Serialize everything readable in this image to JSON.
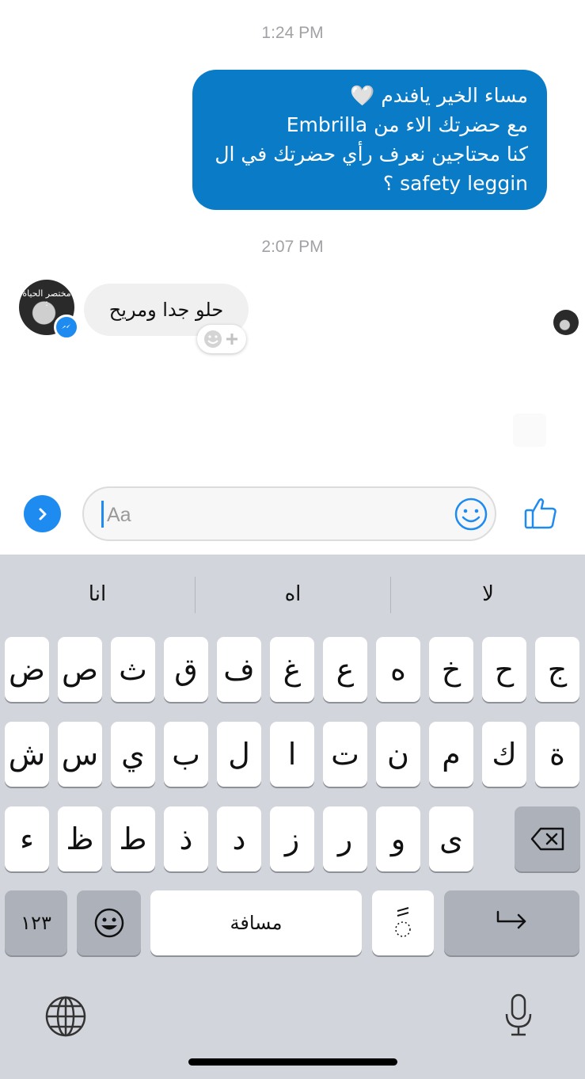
{
  "chat": {
    "timestamp_1": "1:24 PM",
    "timestamp_2": "2:07 PM",
    "sent_message": {
      "lines": [
        "مساء الخير يافندم 🤍",
        "مع حضرتك الاء من Embrilla",
        "كنا محتاجين نعرف رأي حضرتك في ال",
        "safety leggin ؟"
      ]
    },
    "received_message": "حلو جدا ومريح",
    "avatar_text": "مختصر الحياة :"
  },
  "composer": {
    "placeholder": "Aa"
  },
  "keyboard": {
    "suggestions": [
      "انا",
      "اه",
      "لا"
    ],
    "row1": [
      "ض",
      "ص",
      "ث",
      "ق",
      "ف",
      "غ",
      "ع",
      "ه",
      "خ",
      "ح",
      "ج"
    ],
    "row2": [
      "ش",
      "س",
      "ي",
      "ب",
      "ل",
      "ا",
      "ت",
      "ن",
      "م",
      "ك",
      "ة"
    ],
    "row3": [
      "ء",
      "ظ",
      "ط",
      "ذ",
      "د",
      "ز",
      "ر",
      "و",
      "ى"
    ],
    "numbers_key": "١٢٣",
    "space_key": "مسافة",
    "diacritic_key": "ًّ"
  },
  "colors": {
    "sent_bubble": "#0a7cc7",
    "accent": "#1e8bf0",
    "received_bubble": "#f1f0f0",
    "keyboard_bg": "#d2d5db"
  },
  "icons": {
    "chevron": "chevron-right-icon",
    "emoji": "smiley-icon",
    "like": "thumbs-up-icon",
    "backspace": "backspace-icon",
    "return": "return-icon",
    "globe": "globe-icon",
    "mic": "microphone-icon",
    "messenger_badge": "messenger-icon",
    "add_reaction": "add-reaction-icon"
  }
}
